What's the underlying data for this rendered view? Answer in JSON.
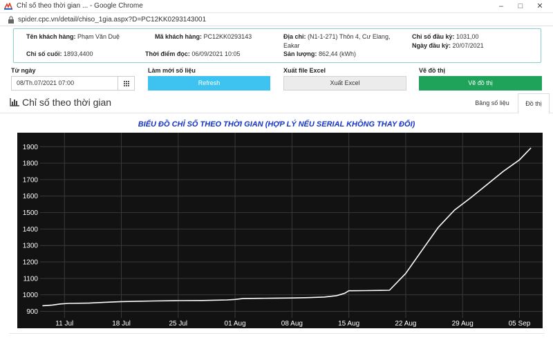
{
  "window": {
    "title": "Chỉ số theo thời gian ... - Google Chrome",
    "url": "spider.cpc.vn/detail/chiso_1gia.aspx?D=PC12KK0293143001"
  },
  "info": {
    "customer_name_label": "Tên khách hàng:",
    "customer_name": "Phạm Văn Duệ",
    "customer_code_label": "Mã khách hàng:",
    "customer_code": "PC12KK0293143",
    "address_label": "Địa chỉ:",
    "address_line1": "(N1-1-271) Thôn 4, Cư Elang,",
    "address_line2": "Eakar",
    "start_index_label": "Chỉ số đầu kỳ:",
    "start_index": "1031,00",
    "last_index_label": "Chỉ số cuối:",
    "last_index": "1893,4400",
    "read_time_label": "Thời điểm đọc:",
    "read_time": "06/09/2021 10:05",
    "output_label": "Sản lượng:",
    "output": "862,44 (kWh)",
    "start_date_label": "Ngày đầu kỳ:",
    "start_date": "20/07/2021"
  },
  "controls": {
    "from_date_label": "Từ ngày",
    "from_date_value": "08/Th.07/2021 07:00",
    "refresh_label": "Làm mới số liệu",
    "refresh_button": "Refresh",
    "excel_label": "Xuất file Excel",
    "excel_button": "Xuất Excel",
    "chart_label": "Vẽ đồ thị",
    "chart_button": "Vẽ đồ thị"
  },
  "section": {
    "title": "Chỉ số theo thời gian",
    "tab_table": "Bảng số liệu",
    "tab_chart": "Đồ thị"
  },
  "colors": {
    "plot_bg": "#121212",
    "line": "#ffffff",
    "title": "#1433c8"
  },
  "chart_data": {
    "type": "line",
    "title": "BIỂU ĐỒ CHỈ SỐ THEO THỜI GIAN (HỢP LÝ NẾU SERIAL KHÔNG THAY ĐỔI)",
    "xlabel": "",
    "ylabel": "",
    "x_range": [
      "2021-07-08",
      "2021-09-07"
    ],
    "ylim": [
      860,
      1960
    ],
    "y_ticks": [
      900,
      1000,
      1100,
      1200,
      1300,
      1400,
      1500,
      1600,
      1700,
      1800,
      1900
    ],
    "x_ticks": [
      {
        "date": "2021-07-11",
        "label": "11 Jul"
      },
      {
        "date": "2021-07-18",
        "label": "18 Jul"
      },
      {
        "date": "2021-07-25",
        "label": "25 Jul"
      },
      {
        "date": "2021-08-01",
        "label": "01 Aug"
      },
      {
        "date": "2021-08-08",
        "label": "08 Aug"
      },
      {
        "date": "2021-08-15",
        "label": "15 Aug"
      },
      {
        "date": "2021-08-22",
        "label": "22 Aug"
      },
      {
        "date": "2021-08-29",
        "label": "29 Aug"
      },
      {
        "date": "2021-09-05",
        "label": "05 Sep"
      }
    ],
    "grid": true,
    "series": [
      {
        "points": [
          [
            "2021-07-08 07:00",
            934
          ],
          [
            "2021-07-09 12:00",
            938
          ],
          [
            "2021-07-10 12:00",
            945
          ],
          [
            "2021-07-11 12:00",
            948
          ],
          [
            "2021-07-14 00:00",
            950
          ],
          [
            "2021-07-16 00:00",
            955
          ],
          [
            "2021-07-18 00:00",
            959
          ],
          [
            "2021-07-20 00:00",
            961
          ],
          [
            "2021-07-22 00:00",
            963
          ],
          [
            "2021-07-25 00:00",
            965
          ],
          [
            "2021-07-28 00:00",
            966
          ],
          [
            "2021-07-31 00:00",
            969
          ],
          [
            "2021-08-01 00:00",
            972
          ],
          [
            "2021-08-02 00:00",
            978
          ],
          [
            "2021-08-04 00:00",
            979
          ],
          [
            "2021-08-06 00:00",
            980
          ],
          [
            "2021-08-08 00:00",
            981
          ],
          [
            "2021-08-10 00:00",
            983
          ],
          [
            "2021-08-12 00:00",
            987
          ],
          [
            "2021-08-13 12:00",
            995
          ],
          [
            "2021-08-14 12:00",
            1010
          ],
          [
            "2021-08-15 00:00",
            1025
          ],
          [
            "2021-08-17 00:00",
            1026
          ],
          [
            "2021-08-19 00:00",
            1027
          ],
          [
            "2021-08-20 00:00",
            1028
          ],
          [
            "2021-08-22 00:00",
            1130
          ],
          [
            "2021-08-24 00:00",
            1270
          ],
          [
            "2021-08-26 00:00",
            1410
          ],
          [
            "2021-08-28 00:00",
            1515
          ],
          [
            "2021-08-30 00:00",
            1590
          ],
          [
            "2021-09-01 00:00",
            1670
          ],
          [
            "2021-09-03 00:00",
            1750
          ],
          [
            "2021-09-05 00:00",
            1820
          ],
          [
            "2021-09-06 10:00",
            1893
          ]
        ]
      }
    ]
  }
}
